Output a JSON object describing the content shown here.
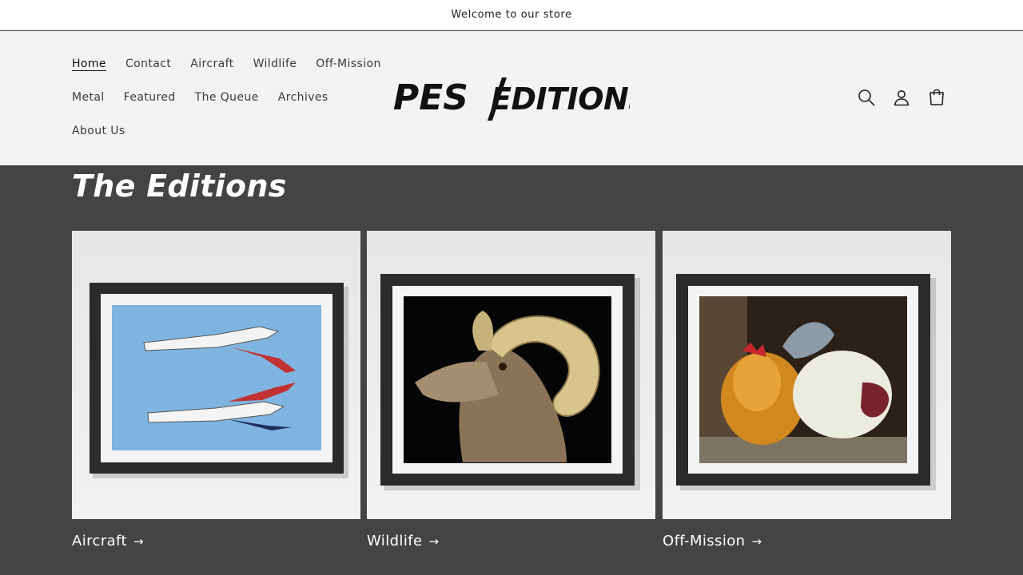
{
  "announcement": {
    "text": "Welcome to our store"
  },
  "nav": {
    "row1": [
      "Home",
      "Contact",
      "Aircraft",
      "Wildlife",
      "Off-Mission"
    ],
    "row2": [
      "Metal",
      "Featured",
      "The Queue",
      "Archives"
    ],
    "row3": [
      "About Us"
    ],
    "active": "Home"
  },
  "logo": {
    "text_left": "PES",
    "text_right": "EDITIONS"
  },
  "icons": {
    "search": "search-icon",
    "account": "account-icon",
    "cart": "cart-icon"
  },
  "section": {
    "title": "The Editions"
  },
  "collections": [
    {
      "label": "Aircraft",
      "arrow": "→"
    },
    {
      "label": "Wildlife",
      "arrow": "→"
    },
    {
      "label": "Off-Mission",
      "arrow": "→"
    }
  ],
  "colors": {
    "page_bg": "#444444",
    "header_bg": "#f3f3f3",
    "accent_text": "#ffffff"
  }
}
